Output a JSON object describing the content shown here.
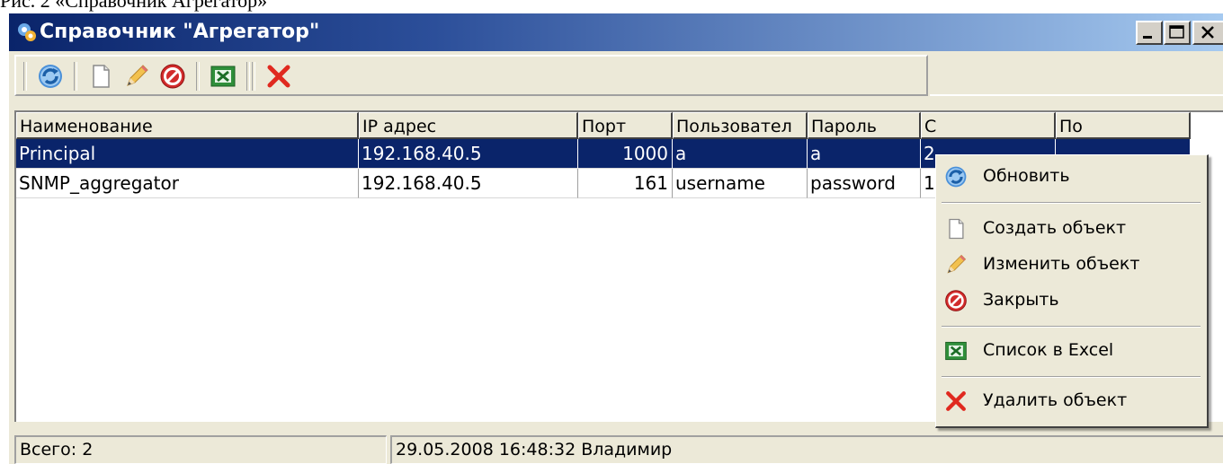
{
  "caption": "Рис. 2 «Справочник Агрегатор»",
  "window": {
    "title": "Справочник \"Агрегатор\"",
    "controls": [
      "minimize-icon",
      "maximize-icon",
      "close-icon"
    ]
  },
  "toolbar": {
    "buttons": [
      {
        "icon": "refresh-icon"
      },
      {
        "icon": "new-document-icon"
      },
      {
        "icon": "pencil-icon"
      },
      {
        "icon": "stop-icon"
      },
      {
        "icon": "excel-icon"
      },
      {
        "icon": "delete-x-icon"
      }
    ]
  },
  "table": {
    "columns": [
      "Наименование",
      "IP адрес",
      "Порт",
      "Пользовател",
      "Пароль",
      "С",
      "По"
    ],
    "rows": [
      {
        "name": "Principal",
        "ip": "192.168.40.5",
        "port": "1000",
        "user": "a",
        "password": "a",
        "from": "2",
        "to": "",
        "selected": true
      },
      {
        "name": "SNMP_aggregator",
        "ip": "192.168.40.5",
        "port": "161",
        "user": "username",
        "password": "password",
        "from": "1",
        "to": "",
        "selected": false
      }
    ]
  },
  "status": {
    "total": "Всего: 2",
    "info": "29.05.2008 16:48:32  Владимир"
  },
  "context_menu": {
    "items": [
      {
        "label": "Обновить",
        "icon": "refresh-icon"
      },
      {
        "label": "Создать объект",
        "icon": "new-document-icon"
      },
      {
        "label": "Изменить объект",
        "icon": "pencil-icon"
      },
      {
        "label": "Закрыть",
        "icon": "stop-icon"
      },
      {
        "label": "Список в Excel",
        "icon": "excel-icon"
      },
      {
        "label": "Удалить объект",
        "icon": "delete-x-icon"
      }
    ]
  },
  "colors": {
    "title_gradient_start": "#0a246a",
    "title_gradient_end": "#a6caf0",
    "selection": "#0a246a",
    "window_face": "#ece9d8"
  }
}
